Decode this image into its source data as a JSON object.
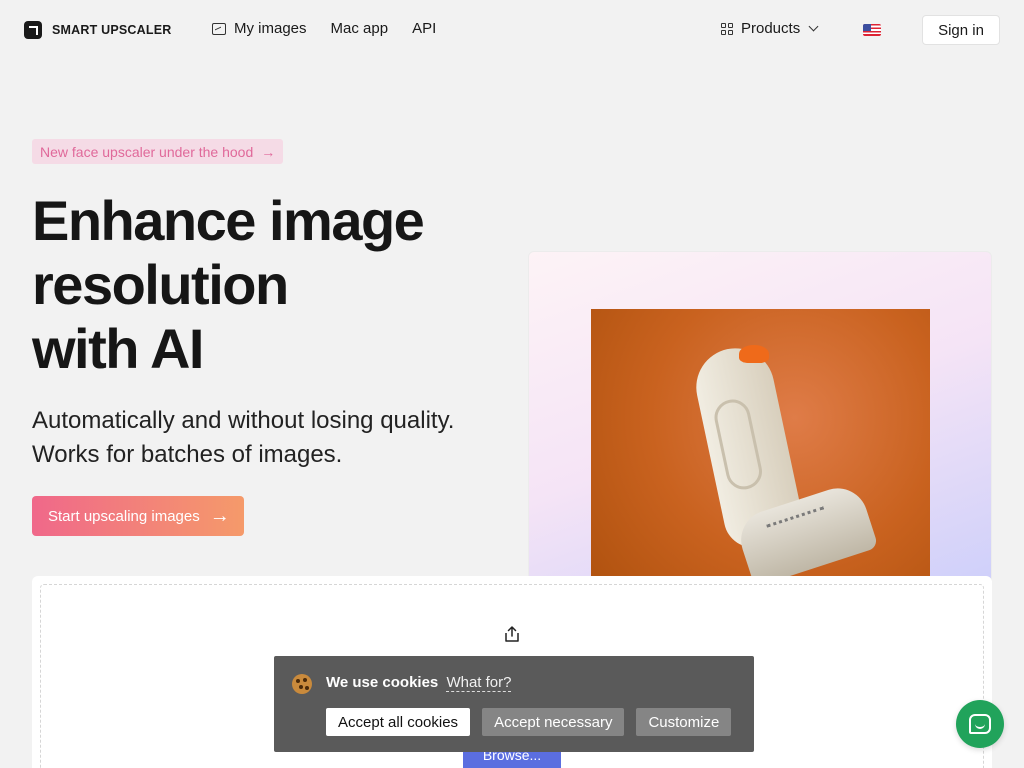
{
  "header": {
    "logo_text": "SMART UPSCALER",
    "nav": [
      {
        "label": "My images",
        "icon": "image-icon"
      },
      {
        "label": "Mac app"
      },
      {
        "label": "API"
      }
    ],
    "products_label": "Products",
    "language_flag": "us-flag",
    "signin_label": "Sign in"
  },
  "hero": {
    "badge_text": "New face upscaler under the hood",
    "title_lines": [
      "Enhance image",
      "resolution",
      "with AI"
    ],
    "subtitle_lines": [
      "Automatically and without losing quality.",
      "Works for batches of images."
    ],
    "cta_label": "Start upscaling images",
    "cta_gradient": [
      "#f0688a",
      "#f59a6a"
    ]
  },
  "upload": {
    "icon": "share-upload-icon",
    "browse_label": "Browse..."
  },
  "cookie_banner": {
    "message": "We use cookies",
    "link_label": "What for?",
    "buttons": {
      "accept_all": "Accept all cookies",
      "accept_necessary": "Accept necessary",
      "customize": "Customize"
    }
  },
  "chat": {
    "icon": "chat-bubble-icon",
    "color": "#21a35b"
  }
}
